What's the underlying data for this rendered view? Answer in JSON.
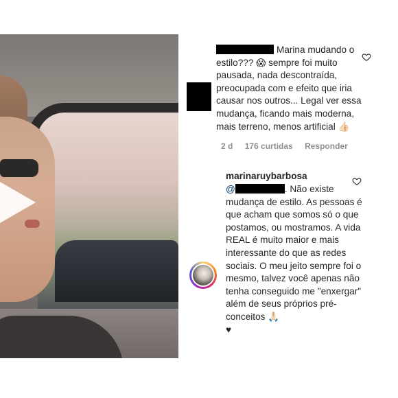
{
  "comment1": {
    "text": "Marina mudando o estilo??? 😱 sempre foi muito pausada, nada descontraída, preocupada com e efeito que iria causar nos outros... Legal ver essa mudança, ficando mais moderna, mais terreno, menos artificial 👍🏻",
    "time": "2 d",
    "likes": "176 curtidas",
    "reply": "Responder"
  },
  "comment2": {
    "username": "marinaruybarbosa",
    "mention_prefix": "@",
    "text": ". Não existe mudança de estilo. As pessoas é que acham que somos só o que postamos, ou mostramos. A vida REAL é muito maior e mais interessante do que as redes sociais. O meu jeito sempre foi o mesmo, talvez você apenas não tenha conseguido me \"enxergar\" além de seus próprios pré-conceitos 🙏🏻",
    "heart_glyph": "♥"
  },
  "icons": {
    "heart": "heart-outline-icon",
    "play": "play-icon"
  },
  "colors": {
    "text": "#262626",
    "meta": "#8e8e8e",
    "mention": "#00376b"
  }
}
